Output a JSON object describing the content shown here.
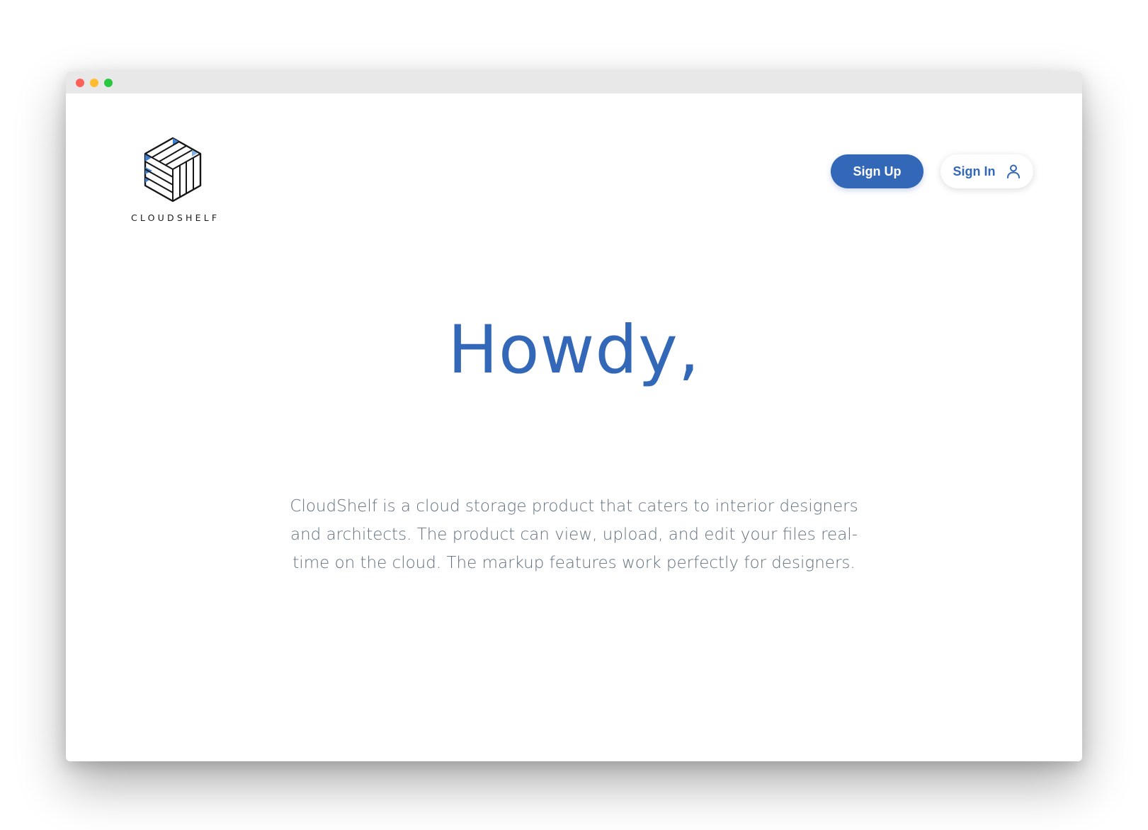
{
  "window": {
    "controls": [
      "close",
      "minimize",
      "zoom"
    ]
  },
  "brand": {
    "name": "CLOUDSHELF",
    "logo_icon": "cube-logo-icon"
  },
  "nav": {
    "signup_label": "Sign Up",
    "signin_label": "Sign In",
    "signin_icon": "user-icon"
  },
  "hero": {
    "headline": "Howdy,",
    "description": "CloudShelf is a cloud storage product that caters to interior designers and architects. The product can view, upload, and edit your files real-time on the cloud. The markup features work perfectly for designers."
  },
  "colors": {
    "accent": "#3367b7",
    "text_muted": "#62707f",
    "titlebar": "#e8e8e8",
    "close": "#fe5f57",
    "minimize": "#febc2e",
    "zoom": "#28c840"
  }
}
